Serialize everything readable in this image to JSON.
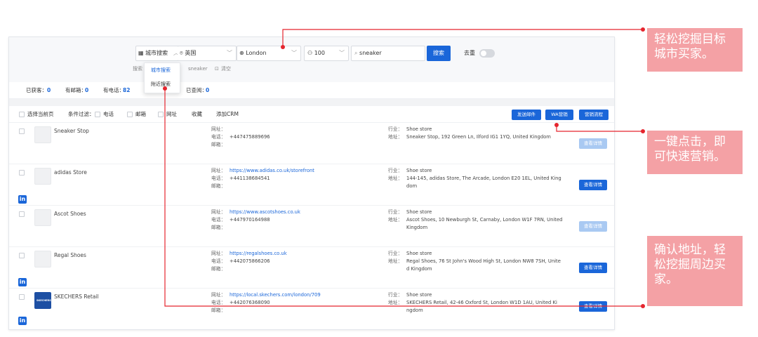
{
  "search_bar": {
    "mode": "城市搜索",
    "country": "英国",
    "city": "London",
    "count": "100",
    "keyword": "sneaker",
    "search_button": "搜索",
    "dedupe_label": "去重",
    "dedupe_on": false
  },
  "history": {
    "label": "搜索",
    "items": [
      "sneaker"
    ],
    "clear": "清空"
  },
  "mode_dropdown": {
    "options": [
      "城市搜索",
      "附近搜索"
    ],
    "selected": "城市搜索"
  },
  "stats": {
    "got_label": "已获客：",
    "got": "0",
    "email_label": "有邮箱：",
    "email": "0",
    "phone_label": "有电话：",
    "phone": "82",
    "viewed_label": "已查阅：",
    "viewed": "0"
  },
  "toolbar": {
    "select_page": "选择当前页",
    "filter": "条件过滤：",
    "filter_phone": "电话",
    "filter_email": "邮箱",
    "filter_site": "网址",
    "favorite": "收藏",
    "add_crm": "添加CRM",
    "send_email": "发送邮件",
    "wa_marketing": "WA营销",
    "marketing_flow": "营销流程"
  },
  "labels": {
    "website": "网址：",
    "phone": "电话：",
    "email": "邮箱：",
    "industry": "行业：",
    "address": "地址：",
    "detail": "查看详情"
  },
  "rows": [
    {
      "name": "Sneaker Stop",
      "website": "",
      "phone": "+447475889696",
      "email": "",
      "industry": "Shoe store",
      "address": "Sneaker Stop, 192 Green Ln, Ilford IG1 1YQ, United Kingdom",
      "linkedin": false
    },
    {
      "name": "adidas Store",
      "website": "https://www.adidas.co.uk/storefront",
      "phone": "+441138684541",
      "email": "",
      "industry": "Shoe store",
      "address": "144-145, adidas Store, The Arcade, London E20 1EL, United King dom",
      "linkedin": true
    },
    {
      "name": "Ascot Shoes",
      "website": "https://www.ascotshoes.co.uk",
      "phone": "+447970164988",
      "email": "",
      "industry": "Shoe store",
      "address": "Ascot Shoes, 10 Newburgh St, Carnaby, London W1F 7RN, United Kingdom",
      "linkedin": false
    },
    {
      "name": "Regal Shoes",
      "website": "https://regalshoes.co.uk",
      "phone": "+442075866206",
      "email": "",
      "industry": "Shoe store",
      "address": "Regal Shoes, 76 St John's Wood High St, London NW8 7SH, Unite d Kingdom",
      "linkedin": true
    },
    {
      "name": "SKECHERS Retail",
      "website": "https://local.skechers.com/london/709",
      "phone": "+442076368090",
      "email": "",
      "industry": "Shoe store",
      "address": "SKECHERS Retail, 42-46 Oxford St, London W1D 1AU, United Ki ngdom",
      "linkedin": true
    }
  ],
  "linkedin_icon": "in",
  "callouts": [
    {
      "line1": "轻松挖掘目标",
      "line2": "城市买家。",
      "line3": ""
    },
    {
      "line1": "一键点击，即",
      "line2": "可快速营销。",
      "line3": ""
    },
    {
      "line1": "确认地址，轻",
      "line2": "松挖掘周边买",
      "line3": "家。"
    }
  ],
  "colors": {
    "accent": "#1a66d9",
    "annotation": "#e5252e",
    "callout_bg": "#f4a1a5"
  }
}
